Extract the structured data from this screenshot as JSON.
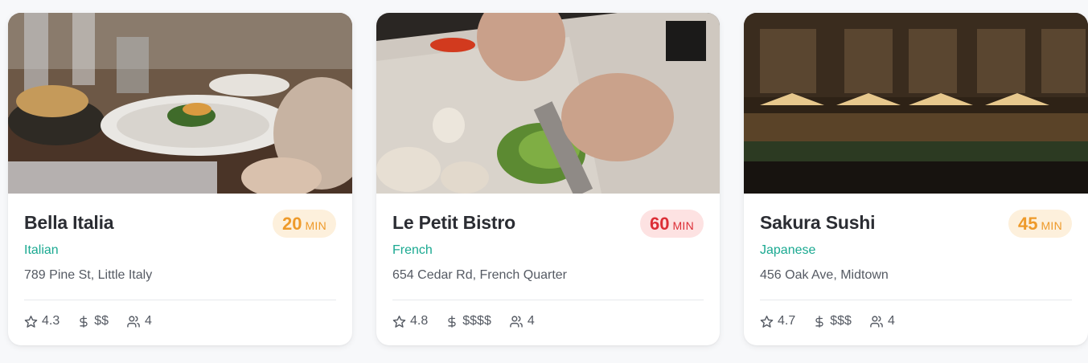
{
  "restaurants": [
    {
      "name": "Bella Italia",
      "cuisine": "Italian",
      "address": "789 Pine St, Little Italy",
      "wait_minutes": "20",
      "wait_unit": "MIN",
      "wait_level": "medium",
      "rating": "4.3",
      "price": "$$",
      "party_size": "4",
      "photo_icon": "plated-dinner-photo"
    },
    {
      "name": "Le Petit Bistro",
      "cuisine": "French",
      "address": "654 Cedar Rd, French Quarter",
      "wait_minutes": "60",
      "wait_unit": "MIN",
      "wait_level": "long",
      "rating": "4.8",
      "price": "$$$$",
      "party_size": "4",
      "photo_icon": "chef-chopping-photo"
    },
    {
      "name": "Sakura Sushi",
      "cuisine": "Japanese",
      "address": "456 Oak Ave, Midtown",
      "wait_minutes": "45",
      "wait_unit": "MIN",
      "wait_level": "medium",
      "rating": "4.7",
      "price": "$$$",
      "party_size": "4",
      "photo_icon": "night-terrace-photo"
    }
  ],
  "colors": {
    "page_background": "#f7f8fa",
    "card_background": "#ffffff",
    "cuisine_text": "#1aa991",
    "wait_medium_bg": "#fdf0dc",
    "wait_medium_text": "#ee9a2a",
    "wait_long_bg": "#fde2e2",
    "wait_long_text": "#dc2e36",
    "muted_text": "#555a63"
  },
  "icons": {
    "rating": "star-icon",
    "price": "dollar-icon",
    "party": "users-icon"
  }
}
